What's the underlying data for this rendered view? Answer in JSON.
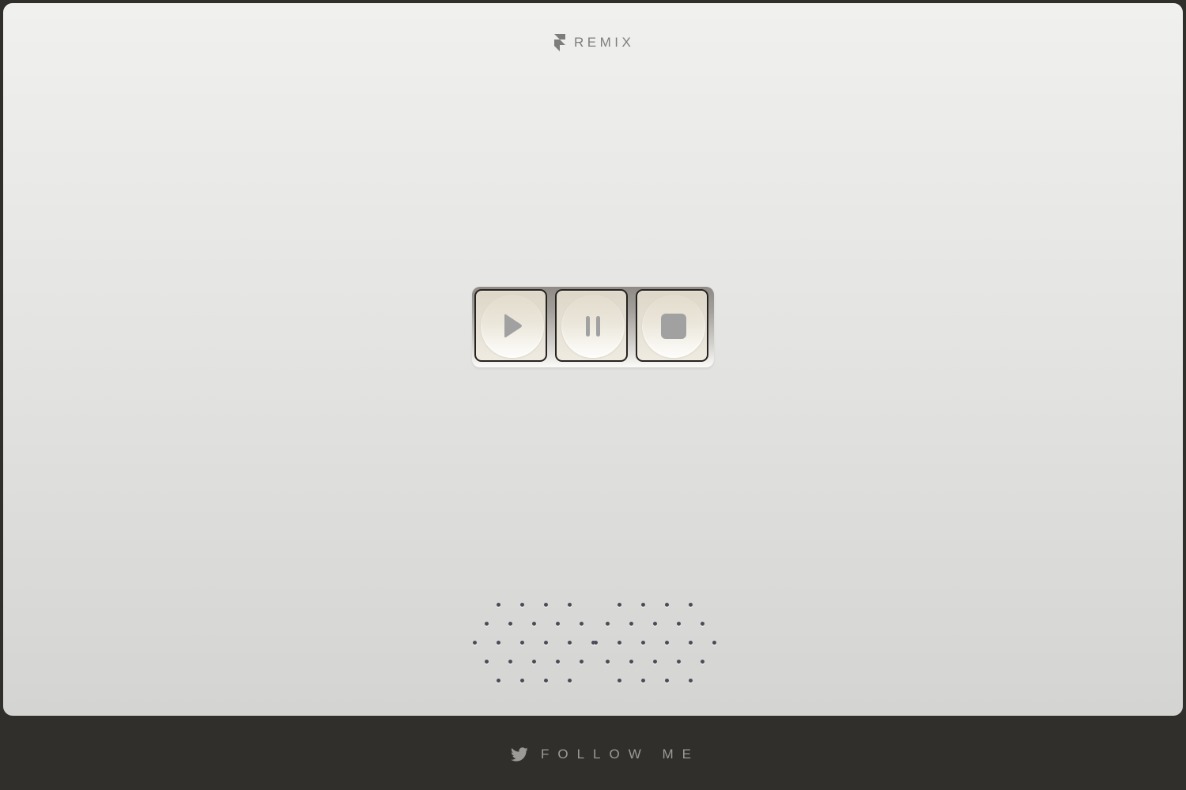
{
  "header": {
    "brand_label": "REMIX",
    "brand_icon": "framer-logo-icon"
  },
  "controls": {
    "buttons": [
      {
        "name": "play",
        "icon": "play-icon"
      },
      {
        "name": "pause",
        "icon": "pause-icon"
      },
      {
        "name": "stop",
        "icon": "stop-icon"
      }
    ]
  },
  "speaker_grille": {
    "rows": [
      4,
      5,
      6,
      5,
      4
    ],
    "dot_color": "#4a4b56"
  },
  "footer": {
    "follow_label": "FOLLOW ME",
    "follow_icon": "twitter-bird-icon"
  },
  "colors": {
    "page_background": "#302f2c",
    "panel_top": "#f0f0ee",
    "panel_bottom": "#d4d4d2",
    "key_face": "#e6e1d5",
    "icon_gray": "#a1a1a1"
  }
}
